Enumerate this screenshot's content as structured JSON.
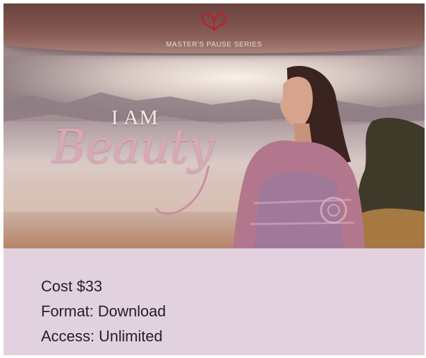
{
  "hero": {
    "series_label": "MASTER'S PAUSE SERIES",
    "title_small": "I AM",
    "title_big": "Beauty",
    "logo_icon": "butterfly-logo-icon",
    "colors": {
      "logo": "#b0253b",
      "banner": "#7a4f48",
      "title": "#d9a8b7"
    }
  },
  "details": {
    "cost": "Cost $33",
    "format": "Format: Download",
    "access": "Access: Unlimited"
  },
  "colors": {
    "card_background": "#e2d2e0",
    "text": "#222222"
  }
}
